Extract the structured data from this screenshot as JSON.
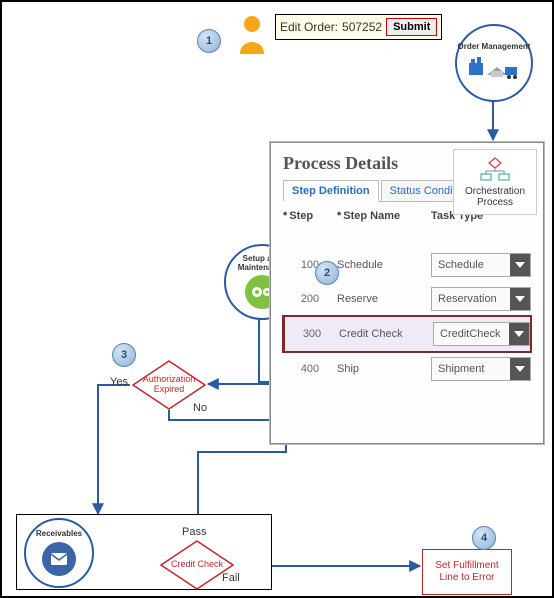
{
  "editOrder": {
    "label": "Edit Order:",
    "number": "507252",
    "submit": "Submit"
  },
  "badges": {
    "s1": "1",
    "s2": "2",
    "s3": "3",
    "s4": "4"
  },
  "orderMgmt": {
    "title": "Order Management"
  },
  "processPanel": {
    "title": "Process Details",
    "tabs": {
      "t1": "Step Definition",
      "t2": "Status Conditions"
    },
    "orch": {
      "line1": "Orchestration",
      "line2": "Process"
    },
    "headers": {
      "step": "Step",
      "stepName": "Step Name",
      "taskType": "Task Type",
      "star": "*"
    },
    "rows": [
      {
        "step": "100",
        "name": "Schedule",
        "type": "Schedule"
      },
      {
        "step": "200",
        "name": "Reserve",
        "type": "Reservation"
      },
      {
        "step": "300",
        "name": "Credit Check",
        "type": "CreditCheck"
      },
      {
        "step": "400",
        "name": "Ship",
        "type": "Shipment"
      }
    ]
  },
  "setupMaint": {
    "title": "Setup and Maintenance"
  },
  "decisions": {
    "authExpired": {
      "label": "Authorization Expired",
      "yes": "Yes",
      "no": "No"
    },
    "creditCheck": {
      "label": "Credit Check",
      "pass": "Pass",
      "fail": "Fail"
    }
  },
  "receivables": {
    "title": "Receivables"
  },
  "setError": {
    "text": "Set Fulfillment Line to Error"
  }
}
